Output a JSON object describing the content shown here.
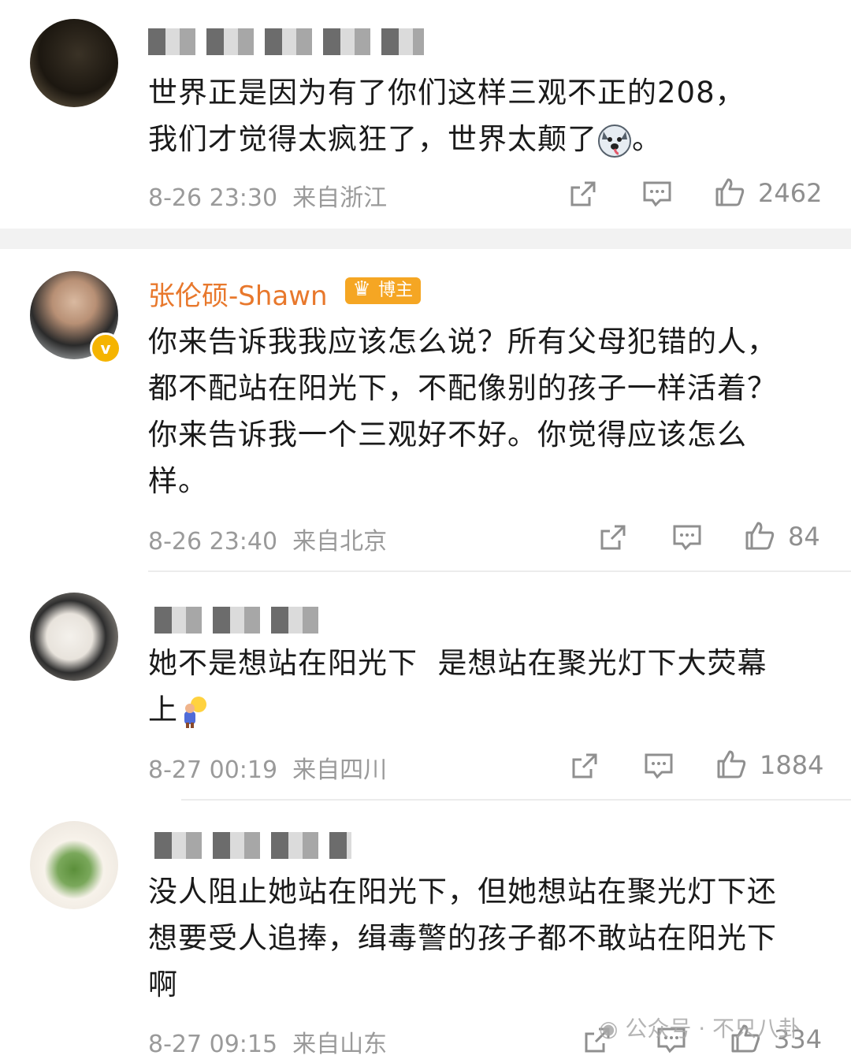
{
  "comments": [
    {
      "username": "",
      "text": "世界正是因为有了你们这样三观不正的208，\n我们才觉得太疯狂了，世界太颠了",
      "text_suffix": "。",
      "time": "8-26 23:30",
      "location": "来自浙江",
      "likes": "2462"
    },
    {
      "username": "张伦硕-Shawn",
      "tag": "博主",
      "text": "你来告诉我我应该怎么说？所有父母犯错的人，\n都不配站在阳光下，不配像别的孩子一样活着？\n你来告诉我一个三观好不好。你觉得应该怎么\n样。",
      "time": "8-26 23:40",
      "location": "来自北京",
      "likes": "84",
      "verified_icon": "v"
    },
    {
      "username": "",
      "text": "她不是想站在阳光下  是想站在聚光灯下大荧幕\n上",
      "time": "8-27 00:19",
      "location": "来自四川",
      "likes": "1884"
    },
    {
      "username": "",
      "text": "没人阻止她站在阳光下，但她想站在聚光灯下还\n想要受人追捧，缉毒警的孩子都不敢站在阳光下\n啊",
      "time": "8-27 09:15",
      "location": "来自山东",
      "likes": "334"
    }
  ],
  "watermark": "公众号 · 不只八卦",
  "icons": [
    "share-icon",
    "comment-icon",
    "like-icon",
    "dog-emoji-icon",
    "lightbulb-emoji-icon",
    "crown-icon",
    "wechat-icon"
  ],
  "colors": {
    "username": "#e8782c",
    "tag": "#f5a623",
    "meta": "#9a9a9a",
    "divider": "#f2f2f2"
  }
}
